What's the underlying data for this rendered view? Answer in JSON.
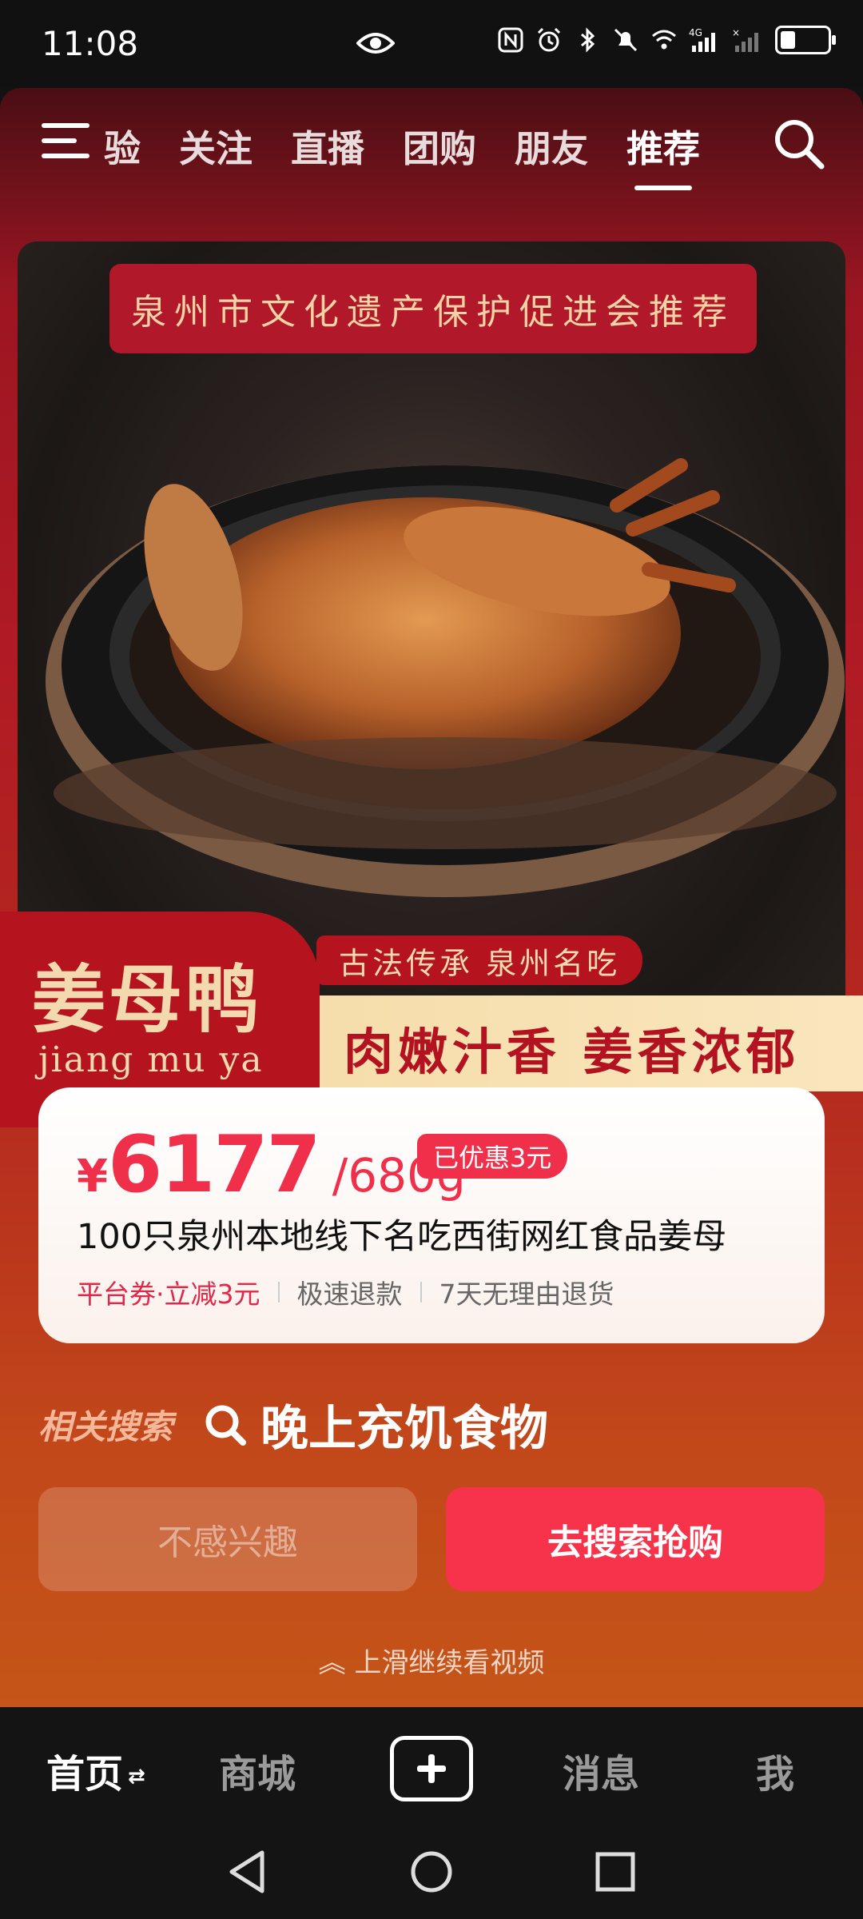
{
  "status": {
    "time": "11:08"
  },
  "tabs": [
    {
      "label": "验"
    },
    {
      "label": "关注"
    },
    {
      "label": "直播"
    },
    {
      "label": "团购"
    },
    {
      "label": "朋友"
    },
    {
      "label": "推荐"
    }
  ],
  "active_tab": "推荐",
  "product_image": {
    "banner": "泉州市文化遗产保护促进会推荐",
    "name_cn": "姜母鸭",
    "name_pinyin": "jiang mu ya",
    "tagline": "古法传承 泉州名吃",
    "slogan": "肉嫩汁香 姜香浓郁"
  },
  "product_card": {
    "currency": "¥",
    "price": "6177",
    "unit": "/680g",
    "discount_badge": "已优惠3元",
    "title": "100只泉州本地线下名吃西街网红食品姜母",
    "perks": [
      "平台券·立减3元",
      "极速退款",
      "7天无理由退货"
    ]
  },
  "related_search": {
    "label": "相关搜索",
    "query": "晚上充饥食物"
  },
  "buttons": {
    "not_interested": "不感兴趣",
    "search_buy": "去搜索抢购"
  },
  "swipe_hint": "上滑继续看视频",
  "bottom_nav": {
    "home": "首页",
    "mall": "商城",
    "messages": "消息",
    "me": "我"
  }
}
